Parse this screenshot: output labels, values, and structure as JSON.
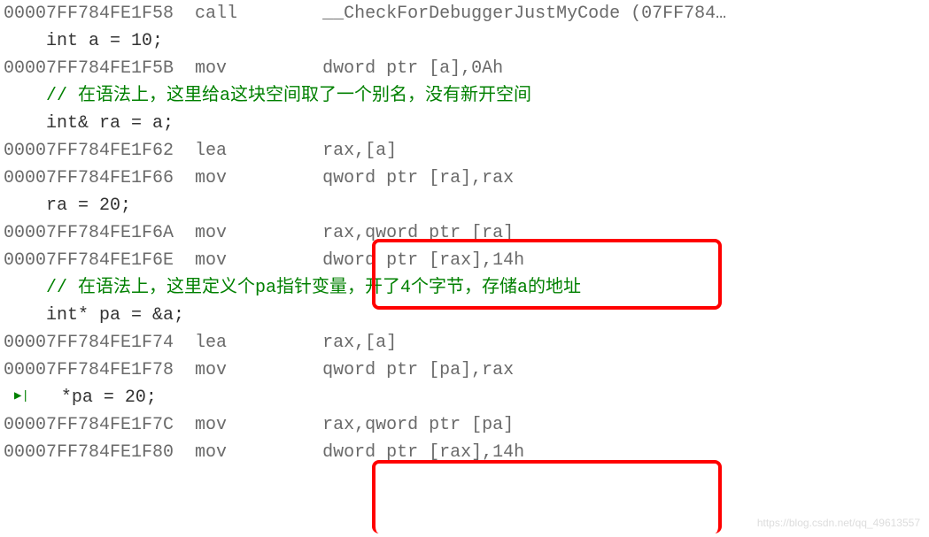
{
  "lines": {
    "l0": {
      "addr": "00007FF784FE1F58",
      "mnemonic": "call",
      "operand": "__CheckForDebuggerJustMyCode (07FF784…"
    },
    "l1": {
      "src": "    int a = 10;"
    },
    "l2": {
      "addr": "00007FF784FE1F5B",
      "mnemonic": "mov",
      "operand": "dword ptr [a],0Ah"
    },
    "l3": {
      "src": ""
    },
    "l4": {
      "src": "    // 在语法上，这里给a这块空间取了一个别名，没有新开空间"
    },
    "l5": {
      "src": "    int& ra = a;"
    },
    "l6": {
      "addr": "00007FF784FE1F62",
      "mnemonic": "lea",
      "operand": "rax,[a]"
    },
    "l7": {
      "addr": "00007FF784FE1F66",
      "mnemonic": "mov",
      "operand": "qword ptr [ra],rax"
    },
    "l8": {
      "src": "    ra = 20;"
    },
    "l9": {
      "addr": "00007FF784FE1F6A",
      "mnemonic": "mov",
      "operand": "rax,qword ptr [ra]"
    },
    "l10": {
      "addr": "00007FF784FE1F6E",
      "mnemonic": "mov",
      "operand": "dword ptr [rax],14h"
    },
    "l11": {
      "src": ""
    },
    "l12": {
      "src": "    // 在语法上，这里定义个pa指针变量，开了4个字节，存储a的地址"
    },
    "l13": {
      "src": "    int* pa = &a;"
    },
    "l14": {
      "addr": "00007FF784FE1F74",
      "mnemonic": "lea",
      "operand": "rax,[a]"
    },
    "l15": {
      "addr": "00007FF784FE1F78",
      "mnemonic": "mov",
      "operand": "qword ptr [pa],rax"
    },
    "l16": {
      "src": "   *pa = 20;",
      "marker": "▶|"
    },
    "l17": {
      "addr": "00007FF784FE1F7C",
      "mnemonic": "mov",
      "operand": "rax,qword ptr [pa]"
    },
    "l18": {
      "addr": "00007FF784FE1F80",
      "mnemonic": "mov",
      "operand": "dword ptr [rax],14h"
    }
  },
  "watermark": "https://blog.csdn.net/qq_49613557"
}
